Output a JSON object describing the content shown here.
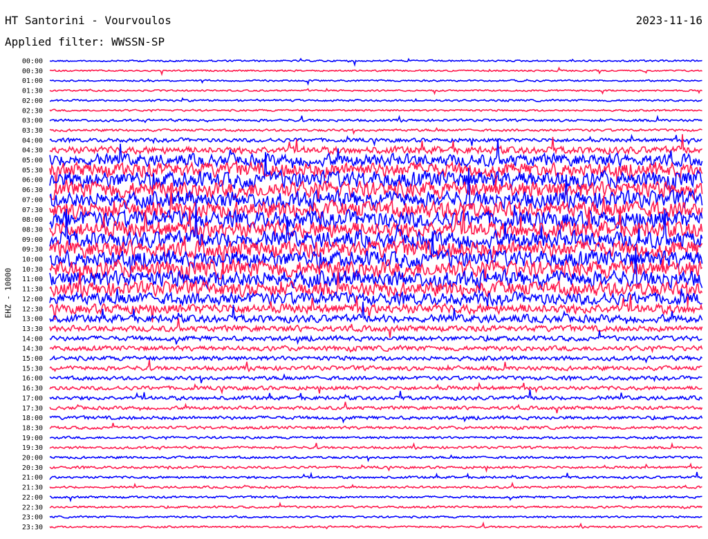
{
  "header": {
    "title": "HT Santorini - Vourvoulos",
    "date": "2023-11-16",
    "filter": "Applied filter: WWSSN-SP"
  },
  "chart_data": {
    "type": "line",
    "ylabel": "EHZ - 10000",
    "trace_colors": [
      "#0000ff",
      "#ff1a4d"
    ],
    "background": "#ffffff",
    "rows": [
      {
        "time": "00:00",
        "amplitude": 0.35
      },
      {
        "time": "00:30",
        "amplitude": 0.35
      },
      {
        "time": "01:00",
        "amplitude": 0.35
      },
      {
        "time": "01:30",
        "amplitude": 0.35
      },
      {
        "time": "02:00",
        "amplitude": 0.4
      },
      {
        "time": "02:30",
        "amplitude": 0.4
      },
      {
        "time": "03:00",
        "amplitude": 0.5
      },
      {
        "time": "03:30",
        "amplitude": 0.5
      },
      {
        "time": "04:00",
        "amplitude": 0.8
      },
      {
        "time": "04:30",
        "amplitude": 1.5
      },
      {
        "time": "05:00",
        "amplitude": 2.5
      },
      {
        "time": "05:30",
        "amplitude": 3.0
      },
      {
        "time": "06:00",
        "amplitude": 3.5
      },
      {
        "time": "06:30",
        "amplitude": 3.5
      },
      {
        "time": "07:00",
        "amplitude": 3.5
      },
      {
        "time": "07:30",
        "amplitude": 3.5
      },
      {
        "time": "08:00",
        "amplitude": 3.5
      },
      {
        "time": "08:30",
        "amplitude": 3.5
      },
      {
        "time": "09:00",
        "amplitude": 3.5
      },
      {
        "time": "09:30",
        "amplitude": 3.5
      },
      {
        "time": "10:00",
        "amplitude": 3.5
      },
      {
        "time": "10:30",
        "amplitude": 3.5
      },
      {
        "time": "11:00",
        "amplitude": 3.5
      },
      {
        "time": "11:30",
        "amplitude": 3.0
      },
      {
        "time": "12:00",
        "amplitude": 2.5
      },
      {
        "time": "12:30",
        "amplitude": 2.0
      },
      {
        "time": "13:00",
        "amplitude": 1.6
      },
      {
        "time": "13:30",
        "amplitude": 1.2
      },
      {
        "time": "14:00",
        "amplitude": 1.0
      },
      {
        "time": "14:30",
        "amplitude": 1.0
      },
      {
        "time": "15:00",
        "amplitude": 0.9
      },
      {
        "time": "15:30",
        "amplitude": 0.9
      },
      {
        "time": "16:00",
        "amplitude": 0.8
      },
      {
        "time": "16:30",
        "amplitude": 0.8
      },
      {
        "time": "17:00",
        "amplitude": 0.8
      },
      {
        "time": "17:30",
        "amplitude": 0.7
      },
      {
        "time": "18:00",
        "amplitude": 0.7
      },
      {
        "time": "18:30",
        "amplitude": 0.6
      },
      {
        "time": "19:00",
        "amplitude": 0.5
      },
      {
        "time": "19:30",
        "amplitude": 0.5
      },
      {
        "time": "20:00",
        "amplitude": 0.5
      },
      {
        "time": "20:30",
        "amplitude": 0.5
      },
      {
        "time": "21:00",
        "amplitude": 0.5
      },
      {
        "time": "21:30",
        "amplitude": 0.45
      },
      {
        "time": "22:00",
        "amplitude": 0.45
      },
      {
        "time": "22:30",
        "amplitude": 0.45
      },
      {
        "time": "23:00",
        "amplitude": 0.4
      },
      {
        "time": "23:30",
        "amplitude": 0.4
      }
    ]
  }
}
